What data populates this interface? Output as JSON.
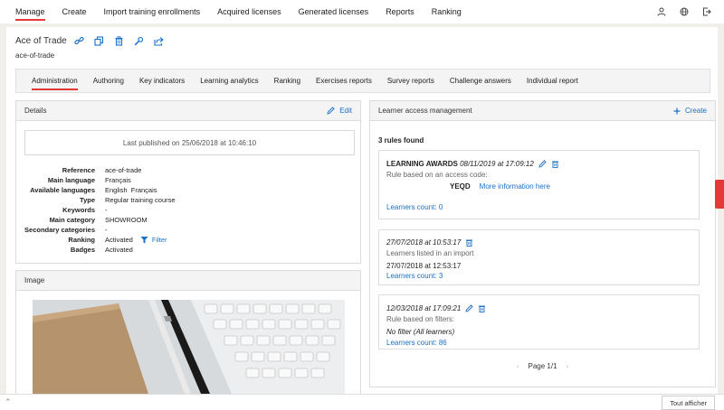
{
  "topnav": {
    "items": [
      "Manage",
      "Create",
      "Import training enrollments",
      "Acquired licenses",
      "Generated licenses",
      "Reports",
      "Ranking"
    ],
    "icons": [
      "user-icon",
      "globe-icon",
      "logout-icon"
    ]
  },
  "header": {
    "title": "Ace of Trade",
    "slug": "ace-of-trade"
  },
  "tabs": [
    "Administration",
    "Authoring",
    "Key indicators",
    "Learning analytics",
    "Ranking",
    "Exercises reports",
    "Survey reports",
    "Challenge answers",
    "Individual report"
  ],
  "details": {
    "title": "Details",
    "edit_label": "Edit",
    "published": "Last published on 25/06/2018 at 10:46:10",
    "rows": [
      {
        "k": "Reference",
        "v": "ace-of-trade"
      },
      {
        "k": "Main language",
        "v": "Français"
      },
      {
        "k": "Available languages",
        "v": "English  Français"
      },
      {
        "k": "Type",
        "v": "Regular training course"
      },
      {
        "k": "Keywords",
        "v": "-"
      },
      {
        "k": "Main category",
        "v": "SHOWROOM"
      },
      {
        "k": "Secondary categories",
        "v": "-"
      },
      {
        "k": "Ranking",
        "v": "Activated"
      },
      {
        "k": "Badges",
        "v": "Activated"
      }
    ],
    "filter_label": "Filter"
  },
  "image_panel": {
    "title": "Image"
  },
  "access": {
    "title": "Learner access management",
    "create_label": "Create",
    "rules_found": "3 rules found",
    "rule1": {
      "name": "LEARNING AWARDS",
      "date": "08/11/2019 at 17:09:12",
      "desc": "Rule based on an access code:",
      "code": "YEQD",
      "more": "More information here",
      "count": "Learners count: 0"
    },
    "rule2": {
      "date": "27/07/2018 at 10:53:17",
      "desc": "Learners listed in an import",
      "listed": "27/07/2018 at 12:53:17",
      "count": "Learners count: 3"
    },
    "rule3": {
      "date": "12/03/2018 at 17:09:21",
      "desc": "Rule based on filters:",
      "filter": "No filter (All learners)",
      "count": "Learners count: 86"
    },
    "pager": "Page 1/1"
  },
  "bottom": {
    "show_all": "Tout afficher"
  },
  "colors": {
    "accent": "#e53935",
    "link": "#1a6fc6"
  }
}
